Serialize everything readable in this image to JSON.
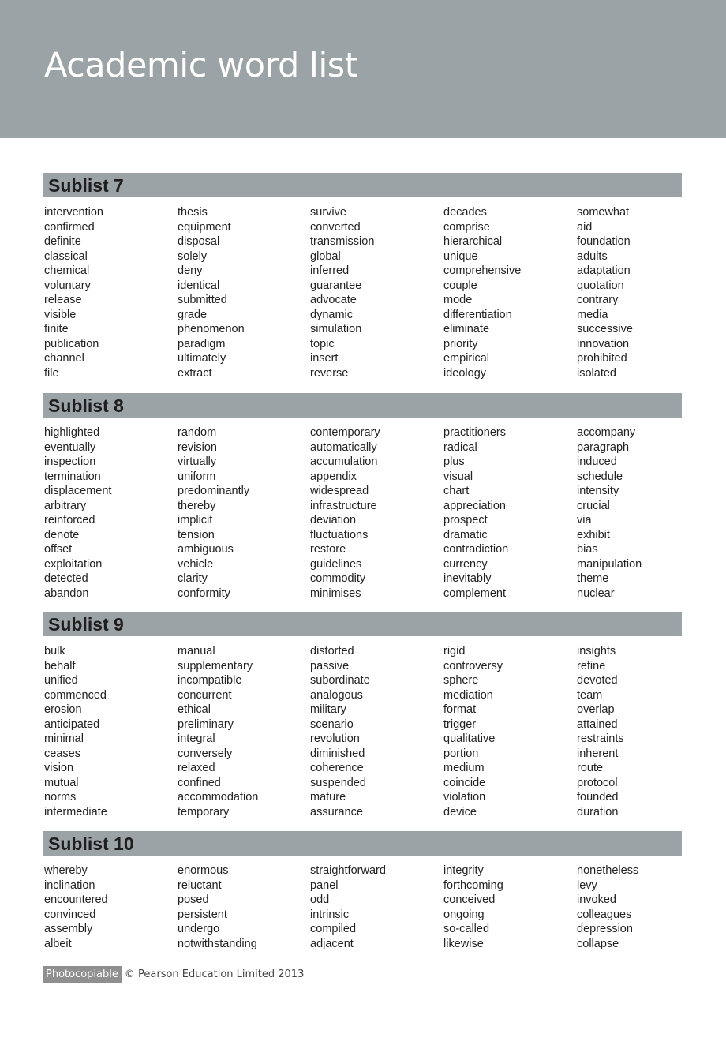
{
  "page": {
    "title": "Academic word list"
  },
  "colors": {
    "banner": "#9ca3a6",
    "header_bar": "#9ca3a6",
    "badge": "#8f8f8f"
  },
  "sublists": [
    {
      "title": "Sublist 7",
      "columns": [
        [
          "intervention",
          "confirmed",
          "definite",
          "classical",
          "chemical",
          "voluntary",
          "release",
          "visible",
          "finite",
          "publication",
          "channel",
          "file"
        ],
        [
          "thesis",
          "equipment",
          "disposal",
          "solely",
          "deny",
          "identical",
          "submitted",
          "grade",
          "phenomenon",
          "paradigm",
          "ultimately",
          "extract"
        ],
        [
          "survive",
          "converted",
          "transmission",
          "global",
          "inferred",
          "guarantee",
          "advocate",
          "dynamic",
          "simulation",
          "topic",
          "insert",
          "reverse"
        ],
        [
          "decades",
          "comprise",
          "hierarchical",
          "unique",
          "comprehensive",
          "couple",
          "mode",
          "differentiation",
          "eliminate",
          "priority",
          "empirical",
          "ideology"
        ],
        [
          "somewhat",
          "aid",
          "foundation",
          "adults",
          "adaptation",
          "quotation",
          "contrary",
          "media",
          "successive",
          "innovation",
          "prohibited",
          "isolated"
        ]
      ]
    },
    {
      "title": "Sublist 8",
      "columns": [
        [
          "highlighted",
          "eventually",
          "inspection",
          "termination",
          "displacement",
          "arbitrary",
          "reinforced",
          "denote",
          "offset",
          "exploitation",
          "detected",
          "abandon"
        ],
        [
          "random",
          "revision",
          "virtually",
          "uniform",
          "predominantly",
          "thereby",
          "implicit",
          "tension",
          "ambiguous",
          "vehicle",
          "clarity",
          "conformity"
        ],
        [
          "contemporary",
          "automatically",
          "accumulation",
          "appendix",
          "widespread",
          "infrastructure",
          "deviation",
          "fluctuations",
          "restore",
          "guidelines",
          "commodity",
          "minimises"
        ],
        [
          "practitioners",
          "radical",
          "plus",
          "visual",
          "chart",
          "appreciation",
          "prospect",
          "dramatic",
          "contradiction",
          "currency",
          "inevitably",
          "complement"
        ],
        [
          "accompany",
          "paragraph",
          "induced",
          "schedule",
          "intensity",
          "crucial",
          "via",
          "exhibit",
          "bias",
          "manipulation",
          "theme",
          "nuclear"
        ]
      ]
    },
    {
      "title": "Sublist 9",
      "columns": [
        [
          "bulk",
          "behalf",
          "unified",
          "commenced",
          "erosion",
          "anticipated",
          "minimal",
          "ceases",
          "vision",
          "mutual",
          "norms",
          "intermediate"
        ],
        [
          "manual",
          "supplementary",
          "incompatible",
          "concurrent",
          "ethical",
          "preliminary",
          "integral",
          "conversely",
          "relaxed",
          "confined",
          "accommodation",
          "temporary"
        ],
        [
          "distorted",
          "passive",
          "subordinate",
          "analogous",
          "military",
          "scenario",
          "revolution",
          "diminished",
          "coherence",
          "suspended",
          "mature",
          "assurance"
        ],
        [
          "rigid",
          "controversy",
          "sphere",
          "mediation",
          "format",
          "trigger",
          "qualitative",
          "portion",
          "medium",
          "coincide",
          "violation",
          "device"
        ],
        [
          "insights",
          "refine",
          "devoted",
          "team",
          "overlap",
          "attained",
          "restraints",
          "inherent",
          "route",
          "protocol",
          "founded",
          "duration"
        ]
      ]
    },
    {
      "title": "Sublist 10",
      "columns": [
        [
          "whereby",
          "inclination",
          "encountered",
          "convinced",
          "assembly",
          "albeit"
        ],
        [
          "enormous",
          "reluctant",
          "posed",
          "persistent",
          "undergo",
          "notwithstanding"
        ],
        [
          "straightforward",
          "panel",
          "odd",
          "intrinsic",
          "compiled",
          "adjacent"
        ],
        [
          "integrity",
          "forthcoming",
          "conceived",
          "ongoing",
          "so-called",
          "likewise"
        ],
        [
          "nonetheless",
          "levy",
          "invoked",
          "colleagues",
          "depression",
          "collapse"
        ]
      ]
    }
  ],
  "footer": {
    "badge": "Photocopiable",
    "copyright": "© Pearson Education Limited 2013"
  }
}
